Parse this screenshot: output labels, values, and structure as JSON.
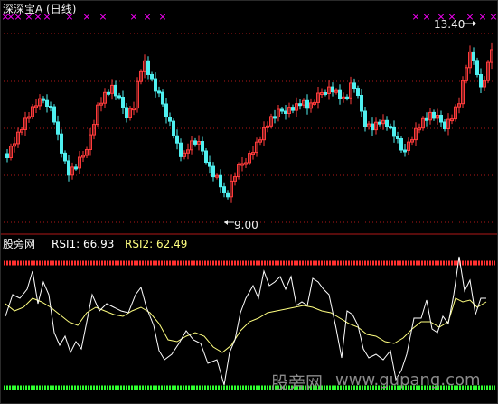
{
  "main_panel": {
    "title": "深深宝A (日线)",
    "high_label": "13.40",
    "low_label": "9.00",
    "signal_mark": "×"
  },
  "indicator_panel": {
    "name": "股旁网",
    "rsi1_label": "RSI1: 66.93",
    "rsi2_label": "RSI2: 62.49"
  },
  "watermark": {
    "cn": "股旁网",
    "url": "www.gupang.com"
  },
  "colors": {
    "background": "#000000",
    "up_candle": "#ff3b3b",
    "down_candle": "#4ff0f0",
    "grid": "#b01818",
    "panel_divider": "#b01818",
    "signal_mark": "#ff00ff",
    "rsi1": "#ffffff",
    "rsi2": "#ffff80",
    "upper_band": "#ff3030",
    "lower_band": "#30ff30"
  }
}
